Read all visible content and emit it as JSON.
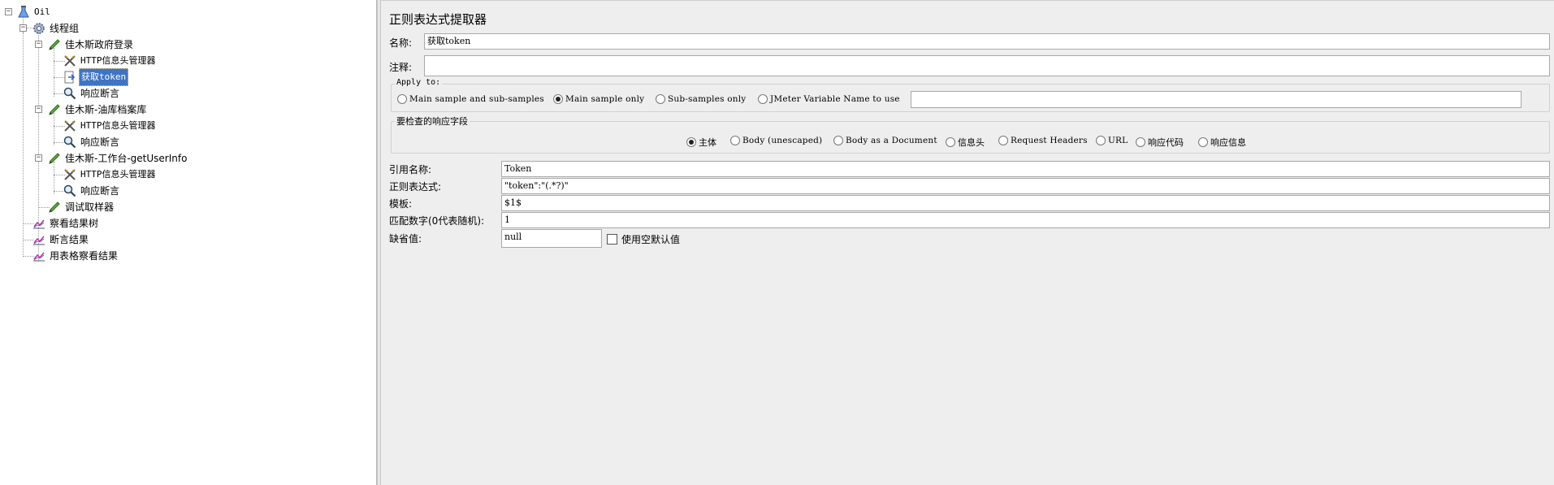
{
  "tree": {
    "root": {
      "label": "Oil",
      "icon": "flask-icon"
    },
    "thread_group": {
      "label": "线程组",
      "icon": "gear-icon"
    },
    "items": [
      {
        "key": "s1",
        "label": "佳木斯政府登录",
        "icon": "sampler-pen-icon"
      },
      {
        "key": "s1a",
        "label": "HTTP信息头管理器",
        "icon": "wrench-icon"
      },
      {
        "key": "s1b",
        "label": "获取token",
        "icon": "extractor-arrow-icon",
        "selected": true
      },
      {
        "key": "s1c",
        "label": "响应断言",
        "icon": "magnifier-icon"
      },
      {
        "key": "s2",
        "label": "佳木斯-油库档案库",
        "icon": "sampler-pen-icon"
      },
      {
        "key": "s2a",
        "label": "HTTP信息头管理器",
        "icon": "wrench-icon"
      },
      {
        "key": "s2b",
        "label": "响应断言",
        "icon": "magnifier-icon"
      },
      {
        "key": "s3",
        "label": "佳木斯-工作台-getUserInfo",
        "icon": "sampler-pen-icon"
      },
      {
        "key": "s3a",
        "label": "HTTP信息头管理器",
        "icon": "wrench-icon"
      },
      {
        "key": "s3b",
        "label": "响应断言",
        "icon": "magnifier-icon"
      },
      {
        "key": "debug",
        "label": "调试取样器",
        "icon": "sampler-pen-icon"
      },
      {
        "key": "l1",
        "label": "察看结果树",
        "icon": "chart-icon"
      },
      {
        "key": "l2",
        "label": "断言结果",
        "icon": "chart-icon"
      },
      {
        "key": "l3",
        "label": "用表格察看结果",
        "icon": "chart-icon"
      }
    ]
  },
  "form": {
    "title": "正则表达式提取器",
    "name_label": "名称:",
    "name_value": "获取token",
    "comment_label": "注释:",
    "comment_value": "",
    "apply_to": {
      "title": "Apply to:",
      "options": [
        {
          "label": "Main sample and sub-samples",
          "checked": false
        },
        {
          "label": "Main sample only",
          "checked": true
        },
        {
          "label": "Sub-samples only",
          "checked": false
        },
        {
          "label": "JMeter Variable Name to use",
          "checked": false
        }
      ],
      "variable_value": ""
    },
    "field_to_check": {
      "title": "要检查的响应字段",
      "options": [
        {
          "label": "主体",
          "checked": true
        },
        {
          "label": "Body (unescaped)",
          "checked": false
        },
        {
          "label": "Body as a Document",
          "checked": false
        },
        {
          "label": "信息头",
          "checked": false
        },
        {
          "label": "Request Headers",
          "checked": false
        },
        {
          "label": "URL",
          "checked": false
        },
        {
          "label": "响应代码",
          "checked": false
        },
        {
          "label": "响应信息",
          "checked": false
        }
      ]
    },
    "ref_name_label": "引用名称:",
    "ref_name_value": "Token",
    "regex_label": "正则表达式:",
    "regex_value": "\"token\":\"(.*?)\"",
    "template_label": "模板:",
    "template_value": "$1$",
    "match_no_label": "匹配数字(0代表随机):",
    "match_no_value": "1",
    "default_label": "缺省值:",
    "default_value": "null",
    "use_empty_default_label": "使用空默认值",
    "use_empty_default_checked": false
  }
}
